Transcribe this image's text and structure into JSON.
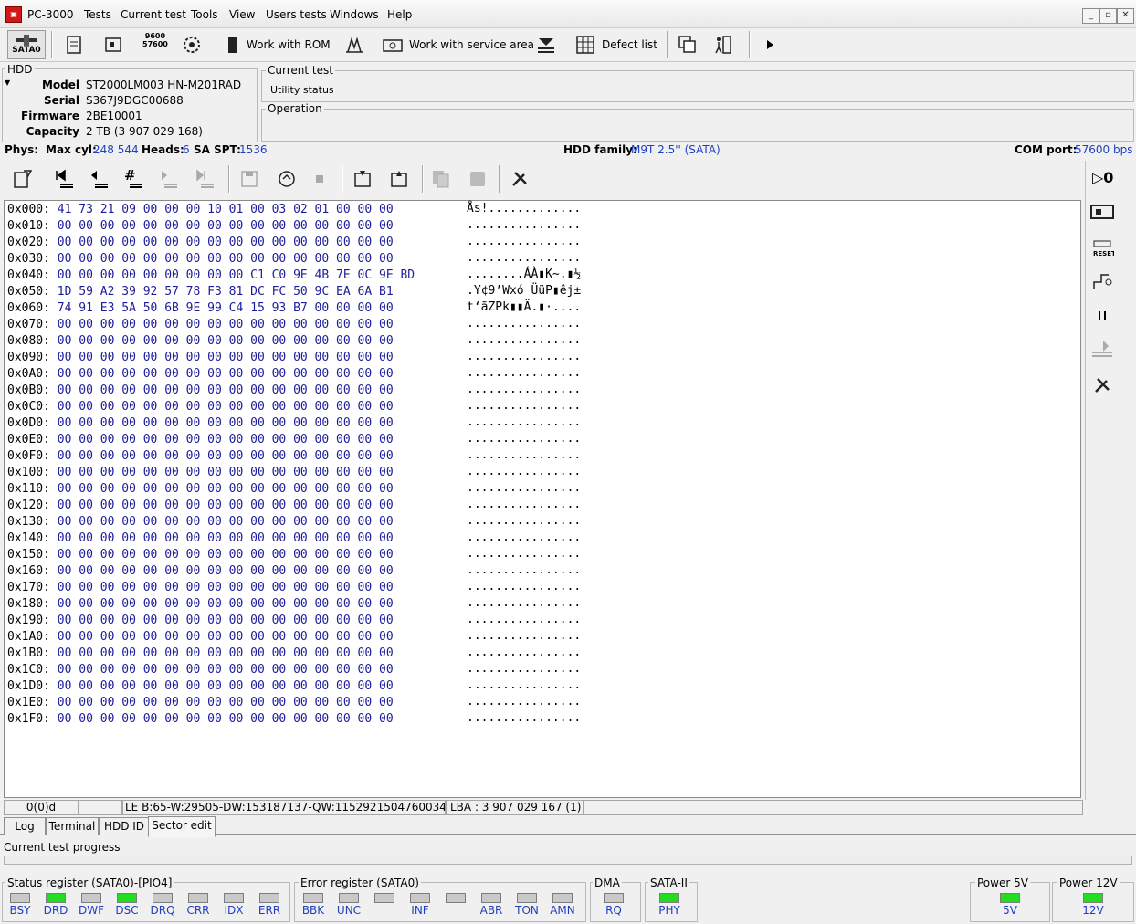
{
  "window": {
    "title": "PC-3000"
  },
  "menu": [
    "Tests",
    "Current test",
    "Tools",
    "View",
    "Users tests",
    "Windows",
    "Help"
  ],
  "toolbar": {
    "port_label": "SATA0",
    "rom_label": "Work with ROM",
    "service_label": "Work with service area",
    "defect_label": "Defect list"
  },
  "hdd": {
    "group_title": "HDD",
    "model_label": "Model",
    "model": "ST2000LM003 HN-M201RAD",
    "serial_label": "Serial",
    "serial": "S367J9DGC00688",
    "firmware_label": "Firmware",
    "firmware": "2BE10001",
    "capacity_label": "Capacity",
    "capacity": "2 TB (3 907 029 168)"
  },
  "current_test": {
    "title": "Current test",
    "value": "Utility status"
  },
  "operation": {
    "title": "Operation"
  },
  "phys": {
    "phys_label": "Phys:",
    "maxcyl_label": "Max cyl:",
    "maxcyl": "248 544",
    "heads_label": "Heads:",
    "heads": "6",
    "saspt_label": "SA SPT:",
    "saspt": "1536",
    "family_label": "HDD family:",
    "family": "M9T 2.5'' (SATA)",
    "com_label": "COM port:",
    "com": "57600 bps"
  },
  "hex": {
    "rows": [
      {
        "addr": "0x000:",
        "bytes": "41 73 21 09 00 00 00 10 01 00 03 02 01 00 00 00",
        "ascii": "Ås!............."
      },
      {
        "addr": "0x010:",
        "bytes": "00 00 00 00 00 00 00 00 00 00 00 00 00 00 00 00",
        "ascii": "................"
      },
      {
        "addr": "0x020:",
        "bytes": "00 00 00 00 00 00 00 00 00 00 00 00 00 00 00 00",
        "ascii": "................"
      },
      {
        "addr": "0x030:",
        "bytes": "00 00 00 00 00 00 00 00 00 00 00 00 00 00 00 00",
        "ascii": "................"
      },
      {
        "addr": "0x040:",
        "bytes": "00 00 00 00 00 00 00 00 00 C1 C0 9E 4B 7E 0C 9E BD",
        "ascii": "........ÁÀ▮K~.▮½"
      },
      {
        "addr": "0x050:",
        "bytes": "1D 59 A2 39 92 57 78 F3 81 DC FC 50 9C EA 6A B1",
        "ascii": ".Y¢9’Wxó ÜüP▮êj±"
      },
      {
        "addr": "0x060:",
        "bytes": "74 91 E3 5A 50 6B 9E 99 C4 15 93 B7 00 00 00 00",
        "ascii": "t‘ãZPk▮▮Ä.▮·...."
      },
      {
        "addr": "0x070:",
        "bytes": "00 00 00 00 00 00 00 00 00 00 00 00 00 00 00 00",
        "ascii": "................"
      },
      {
        "addr": "0x080:",
        "bytes": "00 00 00 00 00 00 00 00 00 00 00 00 00 00 00 00",
        "ascii": "................"
      },
      {
        "addr": "0x090:",
        "bytes": "00 00 00 00 00 00 00 00 00 00 00 00 00 00 00 00",
        "ascii": "................"
      },
      {
        "addr": "0x0A0:",
        "bytes": "00 00 00 00 00 00 00 00 00 00 00 00 00 00 00 00",
        "ascii": "................"
      },
      {
        "addr": "0x0B0:",
        "bytes": "00 00 00 00 00 00 00 00 00 00 00 00 00 00 00 00",
        "ascii": "................"
      },
      {
        "addr": "0x0C0:",
        "bytes": "00 00 00 00 00 00 00 00 00 00 00 00 00 00 00 00",
        "ascii": "................"
      },
      {
        "addr": "0x0D0:",
        "bytes": "00 00 00 00 00 00 00 00 00 00 00 00 00 00 00 00",
        "ascii": "................"
      },
      {
        "addr": "0x0E0:",
        "bytes": "00 00 00 00 00 00 00 00 00 00 00 00 00 00 00 00",
        "ascii": "................"
      },
      {
        "addr": "0x0F0:",
        "bytes": "00 00 00 00 00 00 00 00 00 00 00 00 00 00 00 00",
        "ascii": "................"
      },
      {
        "addr": "0x100:",
        "bytes": "00 00 00 00 00 00 00 00 00 00 00 00 00 00 00 00",
        "ascii": "................"
      },
      {
        "addr": "0x110:",
        "bytes": "00 00 00 00 00 00 00 00 00 00 00 00 00 00 00 00",
        "ascii": "................"
      },
      {
        "addr": "0x120:",
        "bytes": "00 00 00 00 00 00 00 00 00 00 00 00 00 00 00 00",
        "ascii": "................"
      },
      {
        "addr": "0x130:",
        "bytes": "00 00 00 00 00 00 00 00 00 00 00 00 00 00 00 00",
        "ascii": "................"
      },
      {
        "addr": "0x140:",
        "bytes": "00 00 00 00 00 00 00 00 00 00 00 00 00 00 00 00",
        "ascii": "................"
      },
      {
        "addr": "0x150:",
        "bytes": "00 00 00 00 00 00 00 00 00 00 00 00 00 00 00 00",
        "ascii": "................"
      },
      {
        "addr": "0x160:",
        "bytes": "00 00 00 00 00 00 00 00 00 00 00 00 00 00 00 00",
        "ascii": "................"
      },
      {
        "addr": "0x170:",
        "bytes": "00 00 00 00 00 00 00 00 00 00 00 00 00 00 00 00",
        "ascii": "................"
      },
      {
        "addr": "0x180:",
        "bytes": "00 00 00 00 00 00 00 00 00 00 00 00 00 00 00 00",
        "ascii": "................"
      },
      {
        "addr": "0x190:",
        "bytes": "00 00 00 00 00 00 00 00 00 00 00 00 00 00 00 00",
        "ascii": "................"
      },
      {
        "addr": "0x1A0:",
        "bytes": "00 00 00 00 00 00 00 00 00 00 00 00 00 00 00 00",
        "ascii": "................"
      },
      {
        "addr": "0x1B0:",
        "bytes": "00 00 00 00 00 00 00 00 00 00 00 00 00 00 00 00",
        "ascii": "................"
      },
      {
        "addr": "0x1C0:",
        "bytes": "00 00 00 00 00 00 00 00 00 00 00 00 00 00 00 00",
        "ascii": "................"
      },
      {
        "addr": "0x1D0:",
        "bytes": "00 00 00 00 00 00 00 00 00 00 00 00 00 00 00 00",
        "ascii": "................"
      },
      {
        "addr": "0x1E0:",
        "bytes": "00 00 00 00 00 00 00 00 00 00 00 00 00 00 00 00",
        "ascii": "................"
      },
      {
        "addr": "0x1F0:",
        "bytes": "00 00 00 00 00 00 00 00 00 00 00 00 00 00 00 00",
        "ascii": "................"
      }
    ]
  },
  "statusbar": {
    "pos": "0(0)d",
    "le": "LE B:65-W:29505-DW:153187137-QW:1152921504760034113",
    "lba": "LBA : 3 907 029 167 (1)"
  },
  "tabs": [
    "Log",
    "Terminal",
    "HDD ID",
    "Sector edit"
  ],
  "active_tab": "Sector edit",
  "progress": {
    "label": "Current test progress",
    "value": 0
  },
  "status_register": {
    "title": "Status register (SATA0)-[PIO4]",
    "leds": [
      {
        "name": "BSY",
        "on": false
      },
      {
        "name": "DRD",
        "on": true
      },
      {
        "name": "DWF",
        "on": false
      },
      {
        "name": "DSC",
        "on": true
      },
      {
        "name": "DRQ",
        "on": false
      },
      {
        "name": "CRR",
        "on": false
      },
      {
        "name": "IDX",
        "on": false
      },
      {
        "name": "ERR",
        "on": false
      }
    ]
  },
  "error_register": {
    "title": "Error register (SATA0)",
    "leds": [
      {
        "name": "BBK",
        "on": false
      },
      {
        "name": "UNC",
        "on": false
      },
      {
        "name": "",
        "on": false
      },
      {
        "name": "INF",
        "on": false
      },
      {
        "name": "",
        "on": false
      },
      {
        "name": "ABR",
        "on": false
      },
      {
        "name": "TON",
        "on": false
      },
      {
        "name": "AMN",
        "on": false
      }
    ]
  },
  "dma": {
    "title": "DMA",
    "led": "RQ",
    "on": false
  },
  "sata2": {
    "title": "SATA-II",
    "led": "PHY",
    "on": true
  },
  "power5": {
    "title": "Power 5V",
    "led": "5V",
    "on": true
  },
  "power12": {
    "title": "Power 12V",
    "led": "12V",
    "on": true
  },
  "colors": {
    "led_on": "#22dd22",
    "led_off": "#c9c9c9",
    "value_blue": "#2040c0",
    "hex_blue": "#1d1d9a"
  }
}
